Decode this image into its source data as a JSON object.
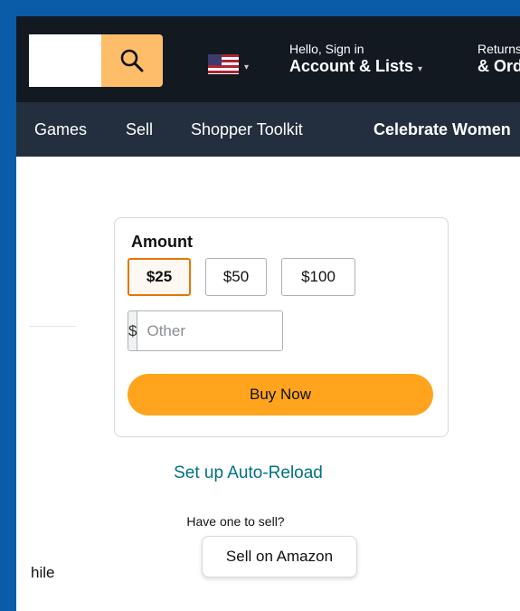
{
  "header": {
    "search_placeholder": "",
    "account_line1": "Hello, Sign in",
    "account_line2": "Account & Lists",
    "account_caret": "▾",
    "returns_line1": "Returns",
    "returns_line2": "& Orders",
    "flag_caret": "▾"
  },
  "nav": {
    "items": [
      "Games",
      "Sell",
      "Shopper Toolkit",
      "Celebrate Women"
    ]
  },
  "purchase": {
    "title": "Amount",
    "amounts": [
      "$25",
      "$50",
      "$100"
    ],
    "selected": "$25",
    "currency_symbol": "$",
    "other_placeholder": "Other",
    "buy_label": "Buy Now"
  },
  "links": {
    "auto_reload": "Set up Auto-Reload",
    "have_one": "Have one to sell?",
    "sell_label": "Sell on Amazon"
  },
  "partial_text": "hile",
  "colors": {
    "header_bg": "#131921",
    "nav_bg": "#232f3e",
    "search_btn": "#febd69",
    "buy_btn": "#ffa41c",
    "link": "#007185",
    "selected_border": "#e77600",
    "outer_frame": "#0a5ca8"
  }
}
